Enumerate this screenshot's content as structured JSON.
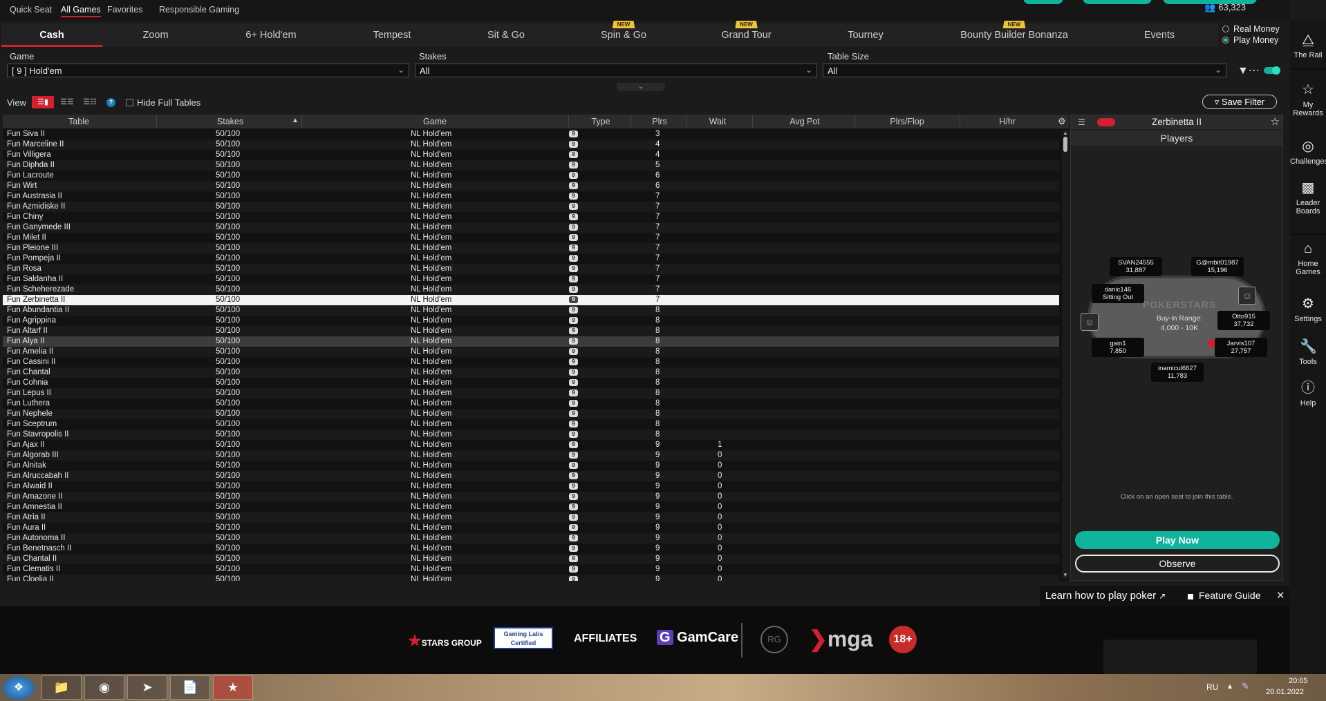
{
  "topbar": {
    "links": [
      "Quick Seat",
      "All Games",
      "Favorites",
      "Responsible Gaming"
    ],
    "active": "All Games",
    "balance": "63,323"
  },
  "tabs": [
    {
      "label": "Cash",
      "active": true,
      "new": false
    },
    {
      "label": "Zoom",
      "active": false,
      "new": false
    },
    {
      "label": "6+ Hold'em",
      "active": false,
      "new": false
    },
    {
      "label": "Tempest",
      "active": false,
      "new": false
    },
    {
      "label": "Sit & Go",
      "active": false,
      "new": false
    },
    {
      "label": "Spin & Go",
      "active": false,
      "new": true
    },
    {
      "label": "Grand Tour",
      "active": false,
      "new": true
    },
    {
      "label": "Tourney",
      "active": false,
      "new": false
    },
    {
      "label": "Bounty Builder Bonanza",
      "active": false,
      "new": true
    },
    {
      "label": "Events",
      "active": false,
      "new": false
    }
  ],
  "new_badge": "NEW",
  "money": {
    "real": "Real Money",
    "play": "Play Money",
    "selected": "Play Money"
  },
  "filters": {
    "game_label": "Game",
    "game_value": "[ 9 ] Hold'em",
    "stakes_label": "Stakes",
    "stakes_value": "All",
    "size_label": "Table Size",
    "size_value": "All"
  },
  "view": {
    "label": "View",
    "hide_full": "Hide Full Tables",
    "save_filter": "Save Filter"
  },
  "grid": {
    "columns": [
      "Table",
      "Stakes",
      "Game",
      "Type",
      "Plrs",
      "Wait",
      "Avg Pot",
      "Plrs/Flop",
      "H/hr"
    ],
    "type_glyph": "9",
    "rows": [
      {
        "table": "Fun Siva II",
        "stakes": "50/100",
        "game": "NL Hold'em",
        "plrs": "3",
        "wait": ""
      },
      {
        "table": "Fun Marceline II",
        "stakes": "50/100",
        "game": "NL Hold'em",
        "plrs": "4",
        "wait": ""
      },
      {
        "table": "Fun Villigera",
        "stakes": "50/100",
        "game": "NL Hold'em",
        "plrs": "4",
        "wait": ""
      },
      {
        "table": "Fun Diphda II",
        "stakes": "50/100",
        "game": "NL Hold'em",
        "plrs": "5",
        "wait": ""
      },
      {
        "table": "Fun Lacroute",
        "stakes": "50/100",
        "game": "NL Hold'em",
        "plrs": "6",
        "wait": ""
      },
      {
        "table": "Fun Wirt",
        "stakes": "50/100",
        "game": "NL Hold'em",
        "plrs": "6",
        "wait": ""
      },
      {
        "table": "Fun Austrasia II",
        "stakes": "50/100",
        "game": "NL Hold'em",
        "plrs": "7",
        "wait": ""
      },
      {
        "table": "Fun Azmidiske II",
        "stakes": "50/100",
        "game": "NL Hold'em",
        "plrs": "7",
        "wait": ""
      },
      {
        "table": "Fun Chiny",
        "stakes": "50/100",
        "game": "NL Hold'em",
        "plrs": "7",
        "wait": ""
      },
      {
        "table": "Fun Ganymede III",
        "stakes": "50/100",
        "game": "NL Hold'em",
        "plrs": "7",
        "wait": ""
      },
      {
        "table": "Fun Milet II",
        "stakes": "50/100",
        "game": "NL Hold'em",
        "plrs": "7",
        "wait": ""
      },
      {
        "table": "Fun Pleione III",
        "stakes": "50/100",
        "game": "NL Hold'em",
        "plrs": "7",
        "wait": ""
      },
      {
        "table": "Fun Pompeja II",
        "stakes": "50/100",
        "game": "NL Hold'em",
        "plrs": "7",
        "wait": ""
      },
      {
        "table": "Fun Rosa",
        "stakes": "50/100",
        "game": "NL Hold'em",
        "plrs": "7",
        "wait": ""
      },
      {
        "table": "Fun Saldanha II",
        "stakes": "50/100",
        "game": "NL Hold'em",
        "plrs": "7",
        "wait": ""
      },
      {
        "table": "Fun Scheherezade",
        "stakes": "50/100",
        "game": "NL Hold'em",
        "plrs": "7",
        "wait": ""
      },
      {
        "table": "Fun Zerbinetta II",
        "stakes": "50/100",
        "game": "NL Hold'em",
        "plrs": "7",
        "wait": "",
        "selected": true
      },
      {
        "table": "Fun Abundantia II",
        "stakes": "50/100",
        "game": "NL Hold'em",
        "plrs": "8",
        "wait": ""
      },
      {
        "table": "Fun Agrippina",
        "stakes": "50/100",
        "game": "NL Hold'em",
        "plrs": "8",
        "wait": ""
      },
      {
        "table": "Fun Altarf II",
        "stakes": "50/100",
        "game": "NL Hold'em",
        "plrs": "8",
        "wait": ""
      },
      {
        "table": "Fun Alya II",
        "stakes": "50/100",
        "game": "NL Hold'em",
        "plrs": "8",
        "wait": "",
        "hover": true
      },
      {
        "table": "Fun Amelia II",
        "stakes": "50/100",
        "game": "NL Hold'em",
        "plrs": "8",
        "wait": ""
      },
      {
        "table": "Fun Cassini II",
        "stakes": "50/100",
        "game": "NL Hold'em",
        "plrs": "8",
        "wait": ""
      },
      {
        "table": "Fun Chantal",
        "stakes": "50/100",
        "game": "NL Hold'em",
        "plrs": "8",
        "wait": ""
      },
      {
        "table": "Fun Cohnia",
        "stakes": "50/100",
        "game": "NL Hold'em",
        "plrs": "8",
        "wait": ""
      },
      {
        "table": "Fun Lepus II",
        "stakes": "50/100",
        "game": "NL Hold'em",
        "plrs": "8",
        "wait": ""
      },
      {
        "table": "Fun Luthera",
        "stakes": "50/100",
        "game": "NL Hold'em",
        "plrs": "8",
        "wait": ""
      },
      {
        "table": "Fun Nephele",
        "stakes": "50/100",
        "game": "NL Hold'em",
        "plrs": "8",
        "wait": ""
      },
      {
        "table": "Fun Sceptrum",
        "stakes": "50/100",
        "game": "NL Hold'em",
        "plrs": "8",
        "wait": ""
      },
      {
        "table": "Fun Stavropolis II",
        "stakes": "50/100",
        "game": "NL Hold'em",
        "plrs": "8",
        "wait": ""
      },
      {
        "table": "Fun Ajax II",
        "stakes": "50/100",
        "game": "NL Hold'em",
        "plrs": "9",
        "wait": "1"
      },
      {
        "table": "Fun Algorab III",
        "stakes": "50/100",
        "game": "NL Hold'em",
        "plrs": "9",
        "wait": "0"
      },
      {
        "table": "Fun Alnitak",
        "stakes": "50/100",
        "game": "NL Hold'em",
        "plrs": "9",
        "wait": "0"
      },
      {
        "table": "Fun Alruccabah II",
        "stakes": "50/100",
        "game": "NL Hold'em",
        "plrs": "9",
        "wait": "0"
      },
      {
        "table": "Fun Alwaid II",
        "stakes": "50/100",
        "game": "NL Hold'em",
        "plrs": "9",
        "wait": "0"
      },
      {
        "table": "Fun Amazone II",
        "stakes": "50/100",
        "game": "NL Hold'em",
        "plrs": "9",
        "wait": "0"
      },
      {
        "table": "Fun Amnestia II",
        "stakes": "50/100",
        "game": "NL Hold'em",
        "plrs": "9",
        "wait": "0"
      },
      {
        "table": "Fun Atria II",
        "stakes": "50/100",
        "game": "NL Hold'em",
        "plrs": "9",
        "wait": "0"
      },
      {
        "table": "Fun Aura II",
        "stakes": "50/100",
        "game": "NL Hold'em",
        "plrs": "9",
        "wait": "0"
      },
      {
        "table": "Fun Autonoma II",
        "stakes": "50/100",
        "game": "NL Hold'em",
        "plrs": "9",
        "wait": "0"
      },
      {
        "table": "Fun Benetnasch II",
        "stakes": "50/100",
        "game": "NL Hold'em",
        "plrs": "9",
        "wait": "0"
      },
      {
        "table": "Fun Chantal II",
        "stakes": "50/100",
        "game": "NL Hold'em",
        "plrs": "9",
        "wait": "0"
      },
      {
        "table": "Fun Clematis II",
        "stakes": "50/100",
        "game": "NL Hold'em",
        "plrs": "9",
        "wait": "0"
      },
      {
        "table": "Fun Cloelia II",
        "stakes": "50/100",
        "game": "NL Hold'em",
        "plrs": "9",
        "wait": "0"
      }
    ]
  },
  "panel": {
    "title": "Zerbinetta II",
    "subtitle": "Players",
    "seats": [
      {
        "name": "SVAN24555",
        "chips": "31,887"
      },
      {
        "name": "G@mbit01987",
        "chips": "15,196"
      },
      {
        "name": "danic146",
        "chips": "Sitting Out"
      },
      {
        "name": "Otto915",
        "chips": "37,732"
      },
      {
        "name": "gain1",
        "chips": "7,850"
      },
      {
        "name": "Jarvis107",
        "chips": "27,757"
      },
      {
        "name": "inamicul6627",
        "chips": "11,783"
      }
    ],
    "brand": "POKERSTARS",
    "buyin_label": "Buy-in Range:",
    "buyin_value": "4,000 - 10K",
    "hint": "Click on an open seat to join this table.",
    "play_now": "Play Now",
    "observe": "Observe"
  },
  "rail": [
    {
      "label": "The Rail",
      "icon": "rail-icon"
    },
    {
      "label": "My Rewards",
      "icon": "star-icon"
    },
    {
      "label": "Challenges",
      "icon": "target-icon"
    },
    {
      "label": "Leader Boards",
      "icon": "bars-icon"
    },
    {
      "label": "Home Games",
      "icon": "home-icon"
    },
    {
      "label": "Settings",
      "icon": "gear-icon"
    },
    {
      "label": "Tools",
      "icon": "wrench-icon"
    },
    {
      "label": "Help",
      "icon": "help-icon"
    }
  ],
  "learn": {
    "text": "Learn how to play poker",
    "guide": "Feature Guide"
  },
  "footer": {
    "logos": [
      "STARS GROUP",
      "Gaming Labs Certified",
      "AFFILIATES",
      "GamCare",
      "RG",
      "mga",
      "18+"
    ]
  },
  "taskbar": {
    "lang": "RU",
    "time": "20:05",
    "date": "20.01.2022"
  },
  "colors": {
    "accent": "#d32030",
    "teal": "#10b39b"
  }
}
